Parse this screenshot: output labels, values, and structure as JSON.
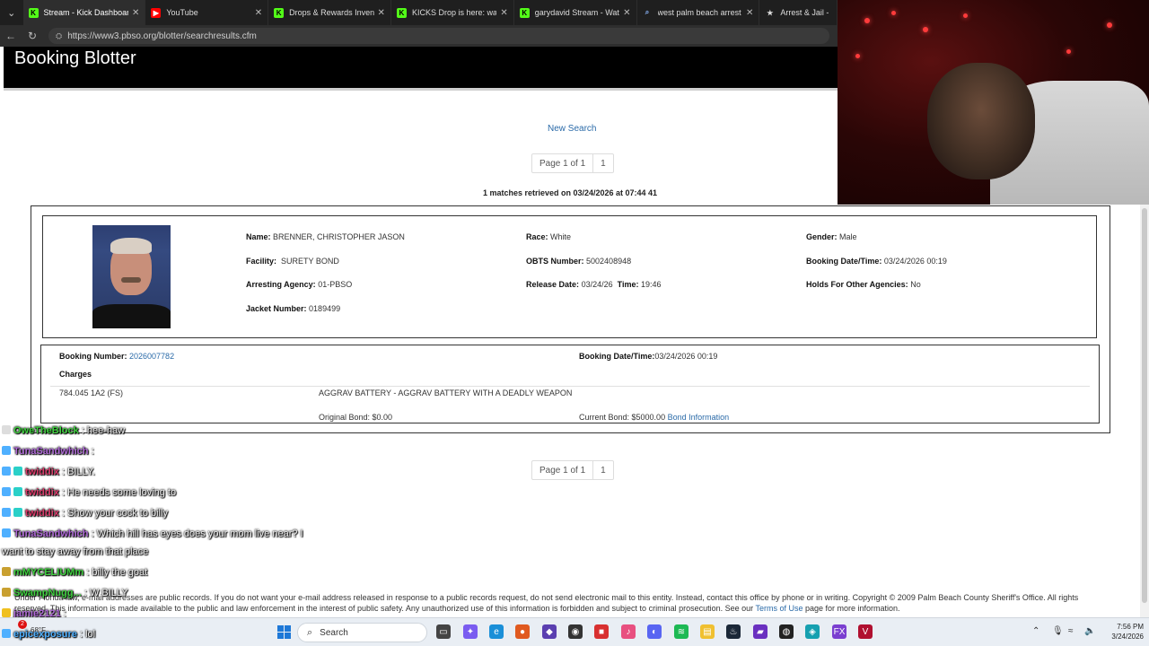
{
  "browser": {
    "tabs": [
      {
        "title": "Stream - Kick Dashboard",
        "icon": "kick-icon",
        "color": "#53fc18"
      },
      {
        "title": "YouTube",
        "icon": "youtube-icon",
        "color": "#ff0000"
      },
      {
        "title": "Drops & Rewards Invent",
        "icon": "kick-icon",
        "color": "#53fc18"
      },
      {
        "title": "KICKS Drop is here: watch, e",
        "icon": "kick-icon",
        "color": "#53fc18"
      },
      {
        "title": "garydavid Stream - Watch Li",
        "icon": "kick-icon",
        "color": "#53fc18"
      },
      {
        "title": "west palm beach arrest sear",
        "icon": "search-icon",
        "color": "#8ab4f8"
      },
      {
        "title": "Arrest & Jail - P",
        "icon": "star-icon",
        "color": "#dddddd"
      }
    ],
    "url": "https://www3.pbso.org/blotter/searchresults.cfm"
  },
  "page": {
    "title": "Booking Blotter",
    "new_search": "New Search",
    "pager": {
      "label": "Page 1 of 1",
      "page": "1"
    },
    "matches": "1 matches retrieved on 03/24/2026 at 07:44 41"
  },
  "inmate": {
    "name_label": "Name:",
    "name": "BRENNER, CHRISTOPHER JASON",
    "facility_label": "Facility:",
    "facility": "SURETY BOND",
    "agency_label": "Arresting Agency:",
    "agency": "01-PBSO",
    "jacket_label": "Jacket Number:",
    "jacket": "0189499",
    "race_label": "Race:",
    "race": "White",
    "obts_label": "OBTS Number:",
    "obts": "5002408948",
    "release_label": "Release Date:",
    "release": "03/24/26",
    "time_label": "Time:",
    "time": "19:46",
    "gender_label": "Gender:",
    "gender": "Male",
    "booking_dt_label": "Booking Date/Time:",
    "booking_dt": "03/24/2026 00:19",
    "holds_label": "Holds For Other Agencies:",
    "holds": "No"
  },
  "booking": {
    "number_label": "Booking Number:",
    "number": "2026007782",
    "dt_label": "Booking Date/Time:",
    "dt": "03/24/2026 00:19",
    "charges_label": "Charges",
    "statute": "784.045 1A2 (FS)",
    "charge": "AGGRAV BATTERY - AGGRAV BATTERY WITH A DEADLY WEAPON",
    "orig_bond": "Original Bond: $0.00",
    "curr_bond": "Current Bond: $5000.00",
    "bond_info": "Bond Information"
  },
  "footer": {
    "line1": "Under Florida law, e-mail addresses are public records. If you do not want your e-mail address released in response to a public records request, do not send electronic mail to this entity. Instead, contact this office by phone or in writing. Copyright © 2009 Palm Beach County Sheriff's Office. All rights",
    "line2a": "reserved. This information is made available to the public and law enforcement in the interest of public safety. Any unauthorized use of this information is forbidden and subject to criminal prosecution. See our",
    "terms": "Terms of Use",
    "line2b": "page for more information."
  },
  "chat": [
    {
      "user": "OweTheBlock",
      "color": "#3fd13f",
      "msg": ": hee-haw"
    },
    {
      "user": "TunaSandwhich",
      "color": "#b06ad8",
      "msg": ":"
    },
    {
      "user": "twiddix",
      "color": "#d83a6a",
      "msg": ": BILLY."
    },
    {
      "user": "twiddix",
      "color": "#d83a6a",
      "msg": ": He needs some loving to"
    },
    {
      "user": "twiddix",
      "color": "#d83a6a",
      "msg": ": Show your cock to billy"
    },
    {
      "user": "TunaSandwhich",
      "color": "#b06ad8",
      "msg": ": Which hill has eyes does your mom live near? I"
    },
    {
      "user": "",
      "color": "#ffffff",
      "msg": "want to stay away from that place"
    },
    {
      "user": "mMYCELIUMm",
      "color": "#3fd13f",
      "msg": ": billy the goat"
    },
    {
      "user": "SwampNugg...",
      "color": "#3fd13f",
      "msg": ": W BILLY"
    },
    {
      "user": "jamie2121",
      "color": "#b06ad8",
      "msg": ":"
    },
    {
      "user": "epicexposure",
      "color": "#4fb0ff",
      "msg": ": lol"
    }
  ],
  "taskbar": {
    "weather": "68°F",
    "search": "Search",
    "time": "7:56 PM",
    "date": "3/24/2026",
    "notif_count": "2"
  }
}
